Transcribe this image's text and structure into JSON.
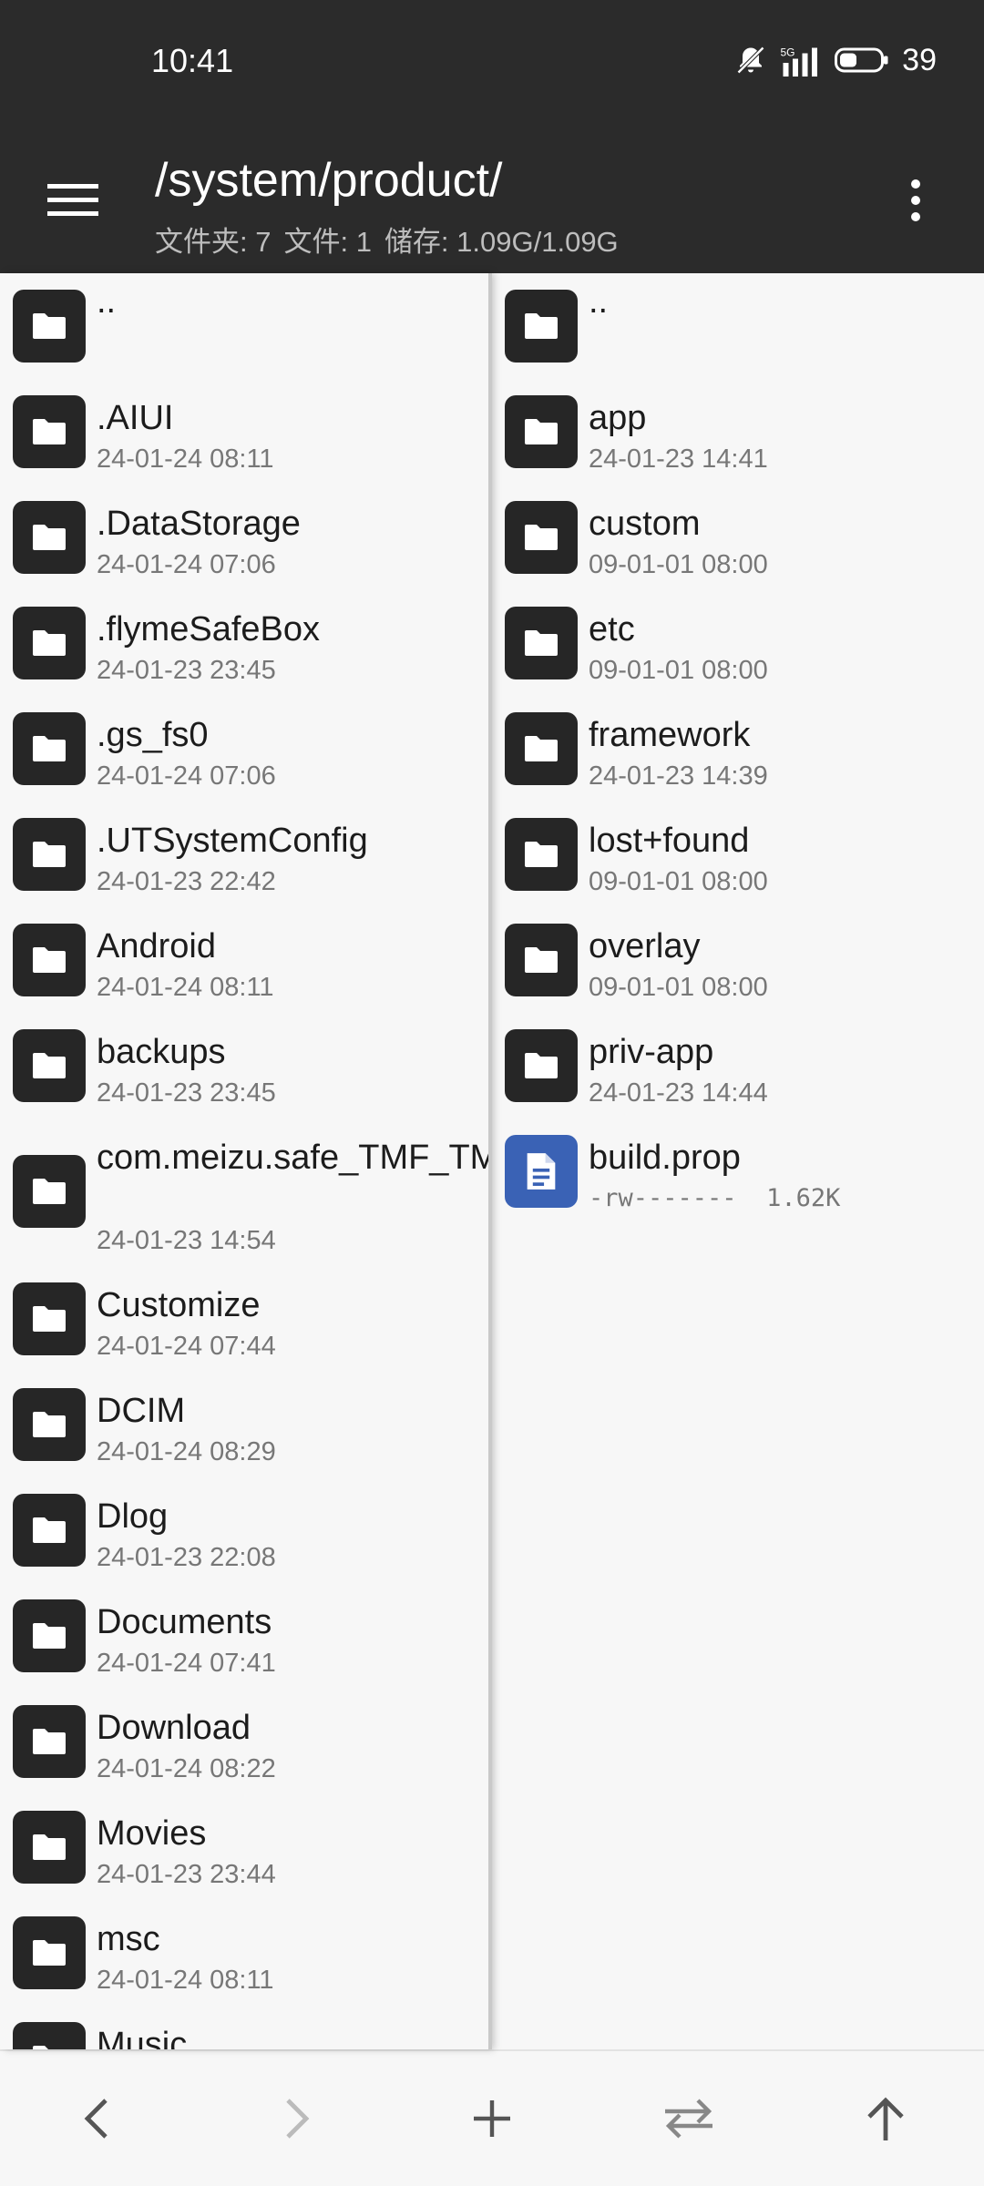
{
  "status_bar": {
    "time": "10:41",
    "battery": "39",
    "network": "5G"
  },
  "toolbar": {
    "path": "/system/product/",
    "folders_label": "文件夹: 7",
    "files_label": "文件: 1",
    "storage_label": "储存: 1.09G/1.09G"
  },
  "left_pane": {
    "parent": "..",
    "items": [
      {
        "name": ".AIUI",
        "date": "24-01-24 08:11"
      },
      {
        "name": ".DataStorage",
        "date": "24-01-24 07:06"
      },
      {
        "name": ".flymeSafeBox",
        "date": "24-01-23 23:45"
      },
      {
        "name": ".gs_fs0",
        "date": "24-01-24 07:06"
      },
      {
        "name": ".UTSystemConfig",
        "date": "24-01-23 22:42"
      },
      {
        "name": "Android",
        "date": "24-01-24 08:11"
      },
      {
        "name": "backups",
        "date": "24-01-23 23:45"
      },
      {
        "name": "com.meizu.safe_TMF_TMS",
        "date": "24-01-23 14:54"
      },
      {
        "name": "Customize",
        "date": "24-01-24 07:44"
      },
      {
        "name": "DCIM",
        "date": "24-01-24 08:29"
      },
      {
        "name": "Dlog",
        "date": "24-01-23 22:08"
      },
      {
        "name": "Documents",
        "date": "24-01-24 07:41"
      },
      {
        "name": "Download",
        "date": "24-01-24 08:22"
      },
      {
        "name": "Movies",
        "date": "24-01-23 23:44"
      },
      {
        "name": "msc",
        "date": "24-01-24 08:11"
      },
      {
        "name": "Music",
        "date": ""
      }
    ]
  },
  "right_pane": {
    "parent": "..",
    "items": [
      {
        "name": "app",
        "date": "24-01-23 14:41"
      },
      {
        "name": "custom",
        "date": "09-01-01 08:00"
      },
      {
        "name": "etc",
        "date": "09-01-01 08:00"
      },
      {
        "name": "framework",
        "date": "24-01-23 14:39"
      },
      {
        "name": "lost+found",
        "date": "09-01-01 08:00"
      },
      {
        "name": "overlay",
        "date": "09-01-01 08:00"
      },
      {
        "name": "priv-app",
        "date": "24-01-23 14:44"
      }
    ],
    "file": {
      "name": "build.prop",
      "perms": "-rw-------",
      "size": "1.62K"
    }
  },
  "colors": {
    "bar": "#2b2b2b",
    "folder_icon": "#262626",
    "file_icon": "#3a62b5"
  }
}
